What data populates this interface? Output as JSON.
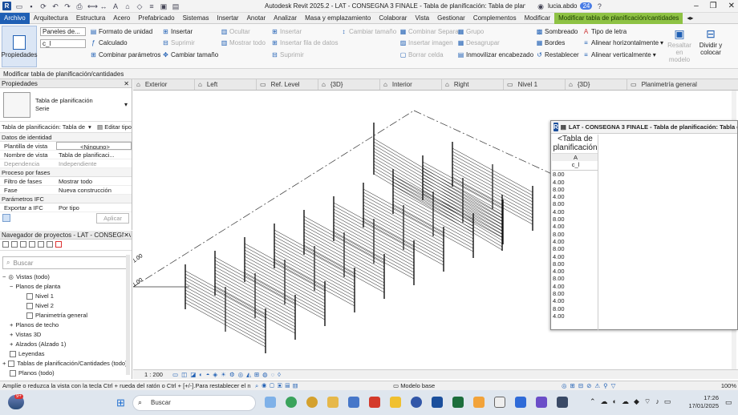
{
  "titlebar": {
    "title": "Autodesk Revit 2025.2 - LAT - CONSEGNA 3 FINALE - Tabla de planificación: Tabla de planificación de paneles",
    "user": "lucia.abdo",
    "badge": "24"
  },
  "tabs": [
    "Archivo",
    "Arquitectura",
    "Estructura",
    "Acero",
    "Prefabricado",
    "Sistemas",
    "Insertar",
    "Anotar",
    "Analizar",
    "Masa y emplazamiento",
    "Colaborar",
    "Vista",
    "Gestionar",
    "Complementos",
    "Modificar",
    "Modificar tabla de planificación/cantidades"
  ],
  "ribbon": {
    "properties_label": "Propiedades",
    "param_select": "Paneles de...",
    "param_value": "c_l",
    "format_unit": "Formato de unidad",
    "calculated": "Calculado",
    "combine": "Combinar parámetros",
    "insert": "Insertar",
    "delete": "Suprimir",
    "hide": "Ocultar",
    "show_all": "Mostrar todo",
    "change_size": "Cambiar tamaño",
    "insert2": "Insertar",
    "insert_data_row": "Insertar fila de datos",
    "delete2": "Suprimir",
    "change_size2": "Cambiar tamaño",
    "merge": "Combinar Separar",
    "insert_image": "Insertar imagen",
    "clear_cell": "Borrar celda",
    "group": "Grupo",
    "ungroup": "Desagrupar",
    "freeze_header": "Inmovilizar encabezado",
    "shading": "Sombreado",
    "borders": "Bordes",
    "reset": "Restablecer",
    "font_type": "Tipo de letra",
    "align_h": "Alinear horizontalmente",
    "align_v": "Alinear verticalmente",
    "highlight": "Resaltar en modelo",
    "split": "Dividir y colocar"
  },
  "optbar": "Modificar tabla de planificación/cantidades",
  "view_tabs": [
    "Exterior",
    "Left",
    "Ref. Level",
    "{3D}",
    "Interior",
    "Right",
    "Nivel 1",
    "{3D}",
    "Planimetría general"
  ],
  "properties": {
    "title": "Propiedades",
    "type_name": "Tabla de planificación",
    "type_sub": "Serie",
    "type_selector": "Tabla de planificación: Tabla de",
    "edit_type": "Editar tipo",
    "sections": [
      {
        "name": "Datos de identidad",
        "rows": [
          [
            "Plantilla de vista",
            "<Ninguno>"
          ],
          [
            "Nombre de vista",
            "Tabla de planificaci..."
          ],
          [
            "Dependencia",
            "Independiente"
          ]
        ]
      },
      {
        "name": "Proceso por fases",
        "rows": [
          [
            "Filtro de fases",
            "Mostrar todo"
          ],
          [
            "Fase",
            "Nueva construcción"
          ]
        ]
      },
      {
        "name": "Parámetros IFC",
        "rows": [
          [
            "Exportar a IFC",
            "Por tipo"
          ]
        ]
      }
    ],
    "apply": "Aplicar"
  },
  "browser": {
    "title": "Navegador de proyectos - LAT - CONSEGNA 3...",
    "search": "Buscar",
    "items": [
      {
        "label": "Vistas (todo)",
        "level": 0
      },
      {
        "label": "Planos de planta",
        "level": 1
      },
      {
        "label": "Nivel 1",
        "level": 2
      },
      {
        "label": "Nivel 2",
        "level": 2
      },
      {
        "label": "Planimetría general",
        "level": 2
      },
      {
        "label": "Planos de techo",
        "level": 1
      },
      {
        "label": "Vistas 3D",
        "level": 1
      },
      {
        "label": "Alzados (Alzado 1)",
        "level": 1
      },
      {
        "label": "Leyendas",
        "level": 0
      },
      {
        "label": "Tablas de planificación/Cantidades (todo)",
        "level": 0
      },
      {
        "label": "Planos (todo)",
        "level": 0
      }
    ]
  },
  "canvas": {
    "level_marks": [
      "1.00",
      "1.00"
    ]
  },
  "schedule": {
    "window_title": "LAT - CONSEGNA 3 FINALE - Tabla de planificación: Tabla de",
    "heading": "<Tabla de planificación",
    "col_letter": "A",
    "col_name": "c_l",
    "values": [
      "8.00",
      "4.00",
      "8.00",
      "4.00",
      "8.00",
      "4.00",
      "8.00",
      "4.00",
      "8.00",
      "4.00",
      "8.00",
      "4.00",
      "8.00",
      "4.00",
      "8.00",
      "4.00",
      "8.00",
      "4.00",
      "8.00",
      "4.00"
    ]
  },
  "viewbar": {
    "scale": "1 : 200"
  },
  "status": {
    "text": "Amplíe o reduzca la vista con la tecla Ctrl + rueda del ratón o Ctrl + [+/-].Para restablecer el niv",
    "model": "Modelo base",
    "zoom": "100%"
  },
  "taskbar": {
    "search": "Buscar",
    "time": "17:26",
    "date": "17/01/2025",
    "notif": "9+"
  }
}
